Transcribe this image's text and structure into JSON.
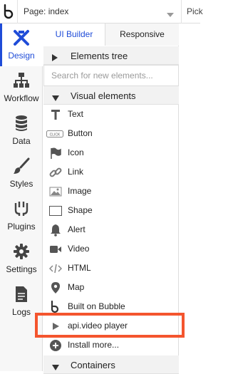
{
  "topbar": {
    "page_label": "Page: index",
    "pick_text": "Pick"
  },
  "sidebar": {
    "items": [
      {
        "label": "Design",
        "icon": "design-icon"
      },
      {
        "label": "Workflow",
        "icon": "workflow-icon"
      },
      {
        "label": "Data",
        "icon": "database-icon"
      },
      {
        "label": "Styles",
        "icon": "brush-icon"
      },
      {
        "label": "Plugins",
        "icon": "plugin-icon"
      },
      {
        "label": "Settings",
        "icon": "gear-icon"
      },
      {
        "label": "Logs",
        "icon": "document-icon"
      }
    ],
    "active": "Design"
  },
  "panel": {
    "tabs": [
      "UI Builder",
      "Responsive"
    ],
    "elements_tree": "Elements tree",
    "search_placeholder": "Search for new elements...",
    "visual_elements": "Visual elements",
    "items": [
      {
        "label": "Text",
        "icon": "text-icon"
      },
      {
        "label": "Button",
        "icon": "button-icon"
      },
      {
        "label": "Icon",
        "icon": "flag-icon"
      },
      {
        "label": "Link",
        "icon": "link-icon"
      },
      {
        "label": "Image",
        "icon": "image-icon"
      },
      {
        "label": "Shape",
        "icon": "shape-icon"
      },
      {
        "label": "Alert",
        "icon": "bell-icon"
      },
      {
        "label": "Video",
        "icon": "video-icon"
      },
      {
        "label": "HTML",
        "icon": "code-icon"
      },
      {
        "label": "Map",
        "icon": "map-pin-icon"
      },
      {
        "label": "Built on Bubble",
        "icon": "bubble-logo-icon"
      },
      {
        "label": "api.video player",
        "icon": "play-icon"
      },
      {
        "label": "Install more...",
        "icon": "plus-circle-icon"
      }
    ],
    "containers": "Containers",
    "button_icon_text": "CLICK"
  },
  "colors": {
    "accent": "#1f4cd8",
    "highlight": "#f4552e"
  }
}
